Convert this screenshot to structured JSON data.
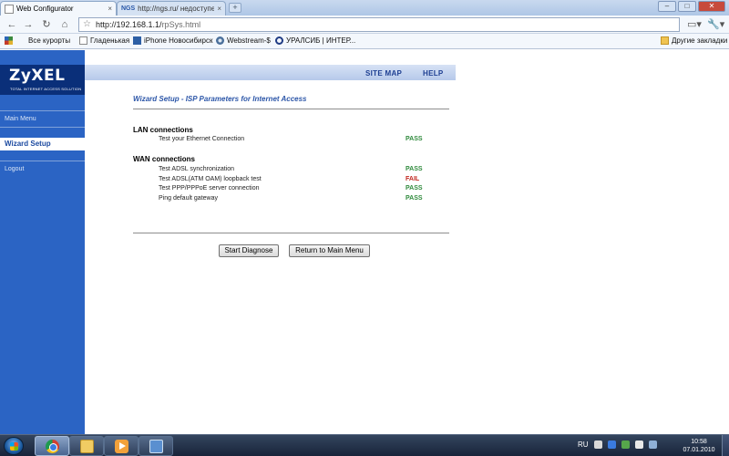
{
  "browser": {
    "tabs": [
      {
        "title": "Web Configurator",
        "close": "×"
      },
      {
        "title": "http://ngs.ru/ недоступен",
        "close": "×",
        "favicon_label": "NGS"
      }
    ],
    "new_tab": "+",
    "window_controls": {
      "minimize": "–",
      "maximize": "□",
      "close": "✕"
    },
    "nav": {
      "back": "←",
      "forward": "→",
      "reload": "↻",
      "home": "⌂"
    },
    "url_host": "http://192.168.1.1/",
    "url_path": "rpSys.html",
    "star": "☆",
    "page_menu": "▭▾",
    "wrench_menu": "🔧▾"
  },
  "bookmarks": {
    "items": [
      {
        "label": "Все курорты",
        "icon": "apps-icon"
      },
      {
        "label": "Гладенькая",
        "icon": "page-icon"
      },
      {
        "label": "iPhone Новосибирск",
        "icon": "site-icon"
      },
      {
        "label": "Webstream-$",
        "icon": "globe-icon"
      },
      {
        "label": "УРАЛСИБ | ИНТЕР...",
        "icon": "bank-icon"
      }
    ],
    "other": "Другие закладки"
  },
  "router": {
    "logo": "ZyXEL",
    "logo_tag": "TOTAL INTERNET ACCESS SOLUTION",
    "top_links": {
      "site_map": "SITE MAP",
      "help": "HELP"
    },
    "sidebar": {
      "main_menu": "Main Menu",
      "wizard_setup": "Wizard Setup",
      "logout": "Logout"
    },
    "title": "Wizard Setup - ISP Parameters for Internet Access",
    "lan": {
      "heading": "LAN connections",
      "tests": [
        {
          "name": "Test your Ethernet Connection",
          "result": "PASS"
        }
      ]
    },
    "wan": {
      "heading": "WAN connections",
      "tests": [
        {
          "name": "Test ADSL synchronization",
          "result": "PASS"
        },
        {
          "name": "Test ADSL(ATM OAM) loopback test",
          "result": "FAIL"
        },
        {
          "name": "Test PPP/PPPoE server connection",
          "result": "PASS"
        },
        {
          "name": "Ping default gateway",
          "result": "PASS"
        }
      ]
    },
    "buttons": {
      "start": "Start Diagnose",
      "return": "Return to Main Menu"
    },
    "colors": {
      "pass": "#2f8a3c",
      "fail": "#c2271f",
      "sidebar": "#2b64c4",
      "accent": "#1e3f92"
    }
  },
  "taskbar": {
    "lang": "RU",
    "time": "10:58",
    "date": "07.01.2010",
    "apps": [
      "chrome-icon",
      "explorer-icon",
      "media-player-icon",
      "network-icon"
    ]
  }
}
